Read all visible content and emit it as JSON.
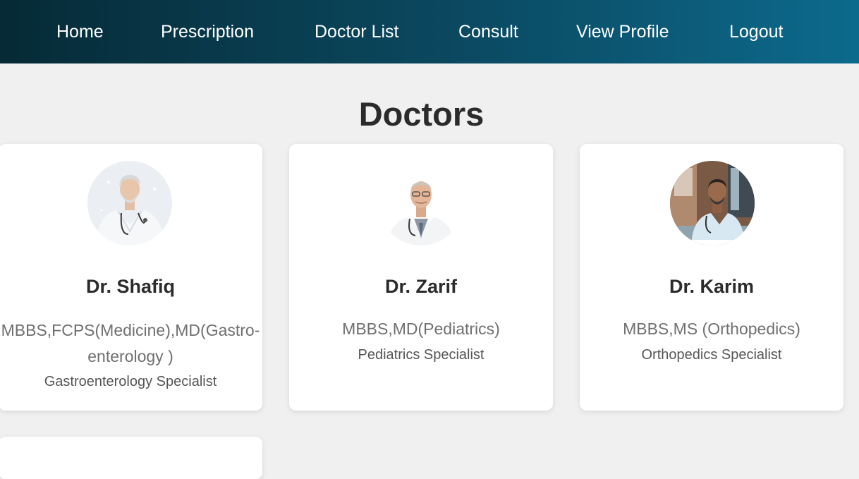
{
  "nav": {
    "items": [
      {
        "label": "Home"
      },
      {
        "label": "Prescription"
      },
      {
        "label": "Doctor List"
      },
      {
        "label": "Consult"
      },
      {
        "label": "View Profile"
      },
      {
        "label": "Logout"
      }
    ]
  },
  "page": {
    "title": "Doctors"
  },
  "doctors": [
    {
      "name": "Dr. Shafiq",
      "degree_line1": "MBBS,FCPS(Medicine),MD(Gastro-",
      "degree_line2": "enterology )",
      "specialty": "Gastroenterology Specialist",
      "photo": "doctor-photo"
    },
    {
      "name": "Dr. Zarif",
      "degree_line1": "MBBS,MD(Pediatrics)",
      "degree_line2": "",
      "specialty": "Pediatrics Specialist",
      "photo": "doctor-photo"
    },
    {
      "name": "Dr. Karim",
      "degree_line1": "MBBS,MS (Orthopedics)",
      "degree_line2": "",
      "specialty": "Orthopedics Specialist",
      "photo": "doctor-photo"
    }
  ]
}
